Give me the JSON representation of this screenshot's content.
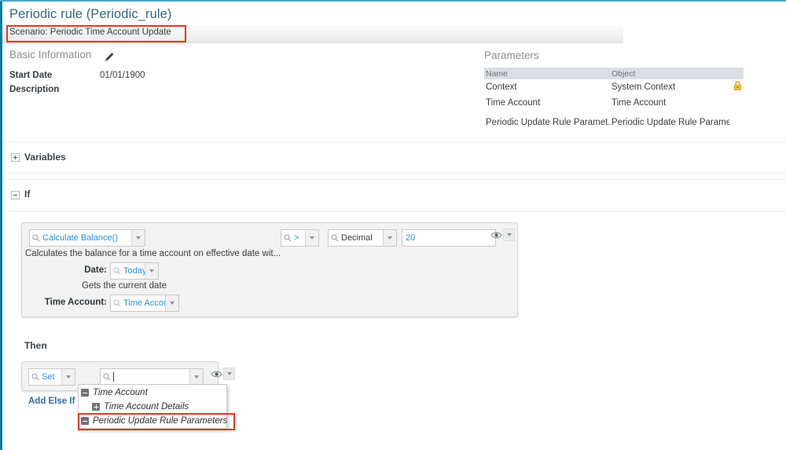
{
  "page": {
    "title": "Periodic rule (Periodic_rule)",
    "scenario": "Scenario: Periodic Time Account Update",
    "accent_color": "#0f7c95",
    "highlight_color": "#ee3124",
    "link_color": "#2d6ca2"
  },
  "basic_information": {
    "heading": "Basic Information",
    "edit_icon": "pencil-icon",
    "fields": [
      {
        "label": "Start Date",
        "value": "01/01/1900"
      },
      {
        "label": "Description",
        "value": ""
      }
    ]
  },
  "parameters": {
    "heading": "Parameters",
    "columns": [
      "Name",
      "Object"
    ],
    "rows": [
      {
        "name": "Context",
        "object": "System Context",
        "locked": true
      },
      {
        "name": "Time Account",
        "object": "Time Account",
        "locked": false
      },
      {
        "name": "Periodic Update Rule Paramet...",
        "object": "Periodic Update Rule Paramet...",
        "locked": false
      }
    ]
  },
  "sections": {
    "variables": {
      "label": "Variables",
      "state": "collapsed",
      "toggle_icon": "plus-box-icon"
    },
    "if": {
      "label": "If",
      "state": "expanded",
      "toggle_icon": "minus-box-icon"
    }
  },
  "condition": {
    "function": {
      "value": "Calculate Balance()",
      "icon": "search-icon"
    },
    "operator": {
      "value": ">",
      "icon": "search-icon"
    },
    "datatype": {
      "value": "Decimal",
      "icon": "search-icon"
    },
    "threshold": {
      "value": "20"
    },
    "description": "Calculates the balance for a time account on effective date wit...",
    "visibility_icon": "eye-icon",
    "params": [
      {
        "label": "Date:",
        "value": "Today()",
        "hint": "Gets the current date"
      },
      {
        "label": "Time Account:",
        "value": "Time Account",
        "hint": ""
      }
    ]
  },
  "then": {
    "label": "Then",
    "action": {
      "value": "Set",
      "icon": "search-icon"
    },
    "target": {
      "value": "",
      "placeholder": "",
      "icon": "search-icon"
    },
    "visibility_icon": "eye-icon",
    "add_else_if": "Add Else If",
    "suggestions": [
      {
        "label": "Time Account",
        "toggle": "minus-box-icon",
        "indent": 0,
        "highlighted": false
      },
      {
        "label": "Time Account Details",
        "toggle": "plus-box-icon",
        "indent": 1,
        "highlighted": false
      },
      {
        "label": "Periodic Update Rule Parameters",
        "toggle": "minus-box-icon",
        "indent": 0,
        "highlighted": true
      }
    ]
  }
}
